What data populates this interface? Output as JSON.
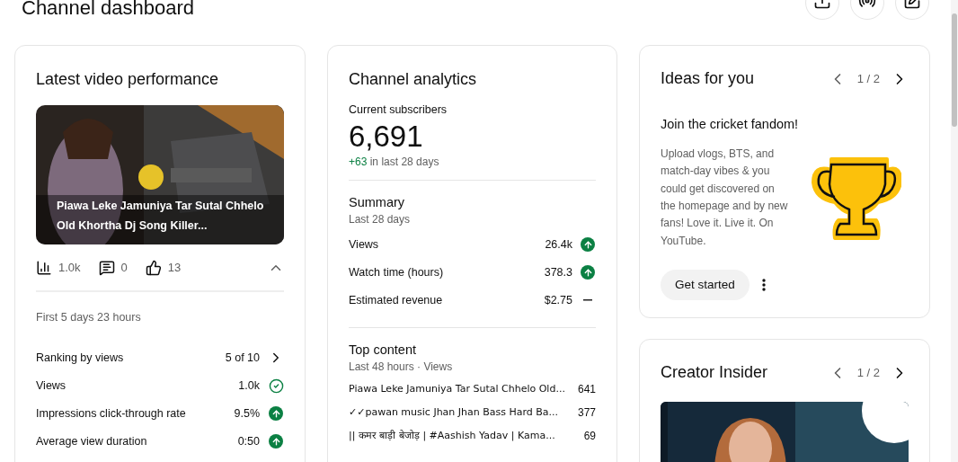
{
  "header": {
    "title": "Channel dashboard"
  },
  "latest_video": {
    "title": "Latest video performance",
    "video_title": "Piawa Leke Jamuniya Tar Sutal Chhelo Old Khortha Dj Song Killer...",
    "stats": [
      {
        "kind": "views",
        "value": "1.0k"
      },
      {
        "kind": "comments",
        "value": "0"
      },
      {
        "kind": "likes",
        "value": "13"
      }
    ],
    "expanded": true,
    "period": "First 5 days 23 hours",
    "metrics": [
      {
        "label": "Ranking by views",
        "value": "5 of 10",
        "kind": "link"
      },
      {
        "label": "Views",
        "value": "1.0k",
        "kind": "check"
      },
      {
        "label": "Impressions click-through rate",
        "value": "9.5%",
        "kind": "up"
      },
      {
        "label": "Average view duration",
        "value": "0:50",
        "kind": "up"
      }
    ]
  },
  "channel_analytics": {
    "title": "Channel analytics",
    "subscribers_label": "Current subscribers",
    "subscribers": "6,691",
    "change": "+63",
    "change_text": "in last 28 days",
    "summary": {
      "title": "Summary",
      "period": "Last 28 days",
      "rows": [
        {
          "label": "Views",
          "value": "26.4k",
          "kind": "up"
        },
        {
          "label": "Watch time (hours)",
          "value": "378.3",
          "kind": "up"
        },
        {
          "label": "Estimated revenue",
          "value": "$2.75",
          "kind": "flat"
        }
      ]
    },
    "top_content": {
      "title": "Top content",
      "period": "Last 48 hours · Views",
      "rows": [
        {
          "title": "Piawa Leke Jamuniya Tar Sutal Chhelo Old...",
          "views": "641"
        },
        {
          "title": "✓✓pawan music Jhan Jhan Bass Hard Ba...",
          "views": "377"
        },
        {
          "title": "|| कमर बाड़ी बेजोड़ | #Aashish Yadav | Kama...",
          "views": "69"
        }
      ]
    }
  },
  "ideas": {
    "title": "Ideas for you",
    "pager": "1 / 2",
    "heading": "Join the cricket fandom!",
    "body": "Upload vlogs, BTS, and match-day vibes & you could get discovered on the homepage and by new fans! Love it. Live it. On YouTube.",
    "button": "Get started"
  },
  "creator_insider": {
    "title": "Creator Insider",
    "pager": "1 / 2"
  }
}
